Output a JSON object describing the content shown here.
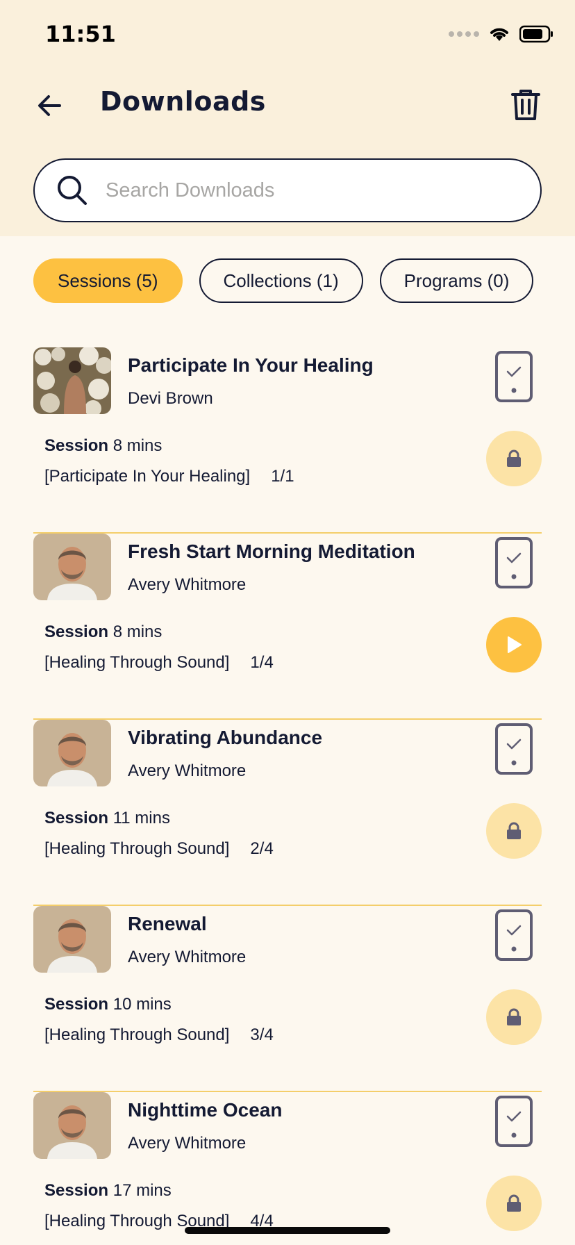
{
  "status_bar": {
    "time": "11:51"
  },
  "header": {
    "title": "Downloads",
    "back_icon": "arrow-left-icon",
    "trash_icon": "trash-icon"
  },
  "search": {
    "placeholder": "Search Downloads",
    "value": ""
  },
  "tabs": [
    {
      "label": "Sessions (5)",
      "active": true
    },
    {
      "label": "Collections (1)",
      "active": false
    },
    {
      "label": "Programs (0)",
      "active": false
    }
  ],
  "colors": {
    "accent": "#FDC141",
    "lock_bg": "#FCE3A6",
    "header_bg": "#FAF0DC",
    "page_bg": "#FDF8EF",
    "text": "#141A33",
    "divider": "#F4CE6A"
  },
  "items": [
    {
      "title": "Participate In Your Healing",
      "author": "Devi Brown",
      "type": "Session",
      "duration": "8 mins",
      "collection": "[Participate In Your Healing]",
      "position": "1/1",
      "action": "lock"
    },
    {
      "title": "Fresh Start Morning Meditation",
      "author": "Avery Whitmore",
      "type": "Session",
      "duration": "8 mins",
      "collection": "[Healing Through Sound]",
      "position": "1/4",
      "action": "play"
    },
    {
      "title": "Vibrating Abundance",
      "author": "Avery Whitmore",
      "type": "Session",
      "duration": "11 mins",
      "collection": "[Healing Through Sound]",
      "position": "2/4",
      "action": "lock"
    },
    {
      "title": "Renewal",
      "author": "Avery Whitmore",
      "type": "Session",
      "duration": "10 mins",
      "collection": "[Healing Through Sound]",
      "position": "3/4",
      "action": "lock"
    },
    {
      "title": "Nighttime Ocean",
      "author": "Avery Whitmore",
      "type": "Session",
      "duration": "17 mins",
      "collection": "[Healing Through Sound]",
      "position": "4/4",
      "action": "lock"
    }
  ]
}
